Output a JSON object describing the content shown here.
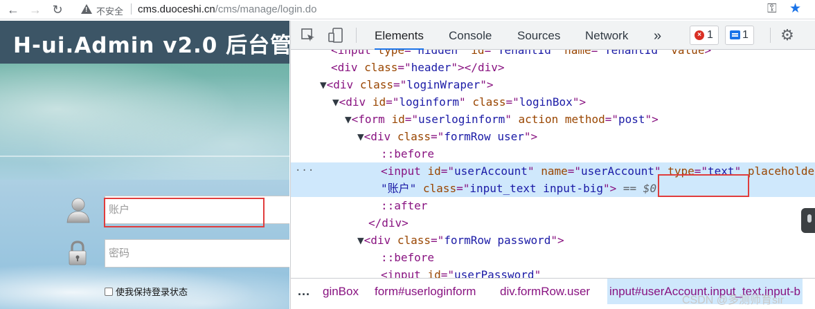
{
  "browser": {
    "back_icon": "arrow-left",
    "forward_icon": "arrow-right",
    "reload_icon": "reload",
    "security_label": "不安全",
    "url_host": "cms.duoceshi.cn",
    "url_path": "/cms/manage/login.do",
    "key_icon": "key",
    "star_icon": "star"
  },
  "page": {
    "title": "H-ui.Admin v2.0 后台管",
    "username_placeholder": "账户",
    "password_placeholder": "密码",
    "remember_label": "使我保持登录状态"
  },
  "devtools": {
    "tabs": [
      "Elements",
      "Console",
      "Sources",
      "Network"
    ],
    "active_tab": "Elements",
    "more_tabs": "»",
    "error_count": "1",
    "message_count": "1",
    "collapse_dots": "···",
    "code_lines": [
      {
        "indent": "  ",
        "html": "<input type=\"hidden\" id=\"TenantId\" name=\"TenantId\" value>"
      },
      {
        "indent": "  ",
        "html": "<div class=\"header\"></div>"
      },
      {
        "indent": "",
        "html": "▼<div class=\"loginWraper\">"
      }
    ],
    "breadcrumb": {
      "more": "...",
      "items": [
        "ginBox",
        "form#userloginform",
        "div.formRow.user",
        "input#userAccount.input_text.input-b"
      ]
    }
  },
  "watermark": "CSDN @多测师育sir",
  "colors": {
    "accent_blue": "#1a73e8",
    "highlight_red": "#e03c3c",
    "selection_bg": "#cfe8fc",
    "tag_purple": "#881280",
    "attr_name_brown": "#994500",
    "attr_value_blue": "#1a1aa6"
  }
}
